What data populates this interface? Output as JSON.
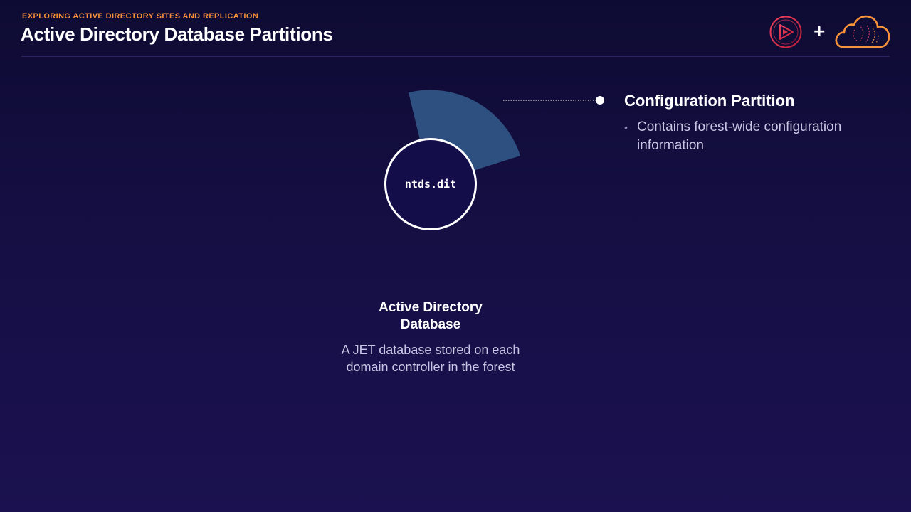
{
  "header": {
    "kicker": "EXPLORING ACTIVE DIRECTORY SITES AND REPLICATION",
    "title": "Active Directory Database Partitions",
    "plus": "+"
  },
  "logos": {
    "left": "pluralsight-play-icon",
    "right": "cloud-brain-icon"
  },
  "diagram": {
    "center_label": "ntds.dit",
    "database_title_line1": "Active Directory",
    "database_title_line2": "Database",
    "database_desc_line1": "A JET database stored on each",
    "database_desc_line2": "domain controller in the forest"
  },
  "partition": {
    "title": "Configuration Partition",
    "bullets": [
      "Contains forest-wide configuration information"
    ]
  },
  "colors": {
    "accent_orange": "#f7923a",
    "sector_blue": "#2e5080",
    "circle_fill": "#130d4a",
    "ps_red": "#e8344a"
  }
}
